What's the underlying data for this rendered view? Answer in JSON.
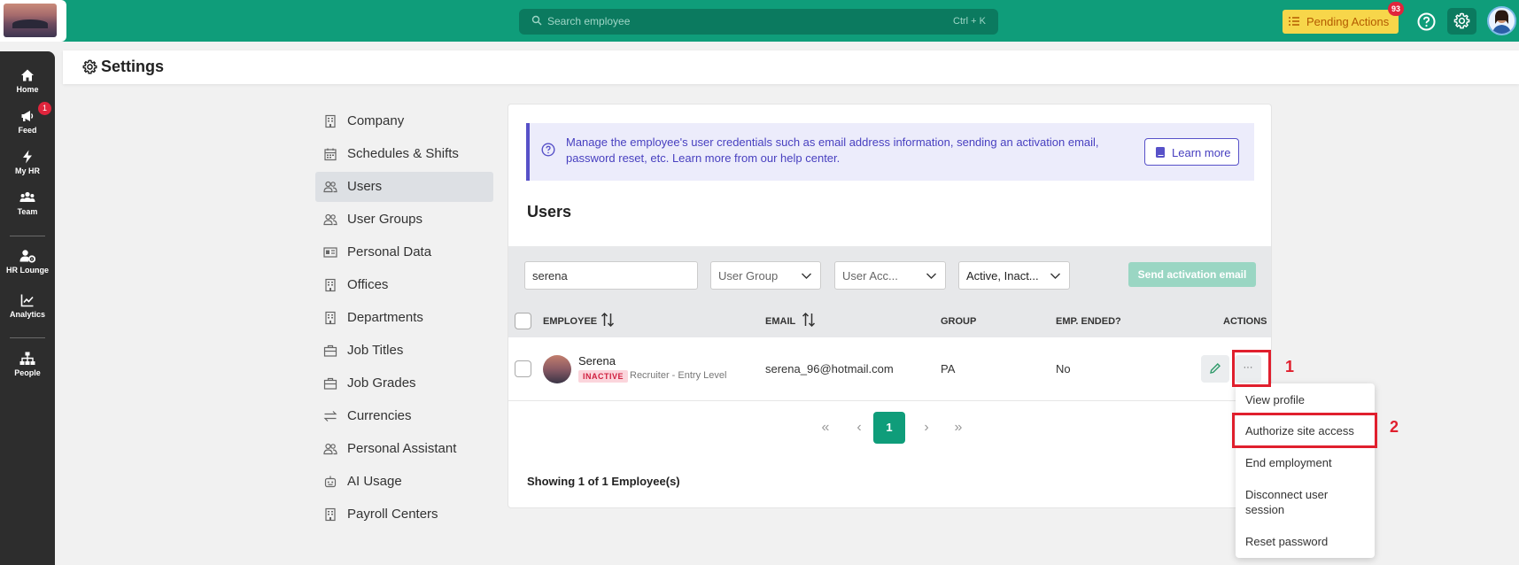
{
  "topbar": {
    "search_placeholder": "Search employee",
    "search_shortcut": "Ctrl + K",
    "pending_label": "Pending Actions",
    "pending_count": "93"
  },
  "sidebar": {
    "items": [
      {
        "label": "Home",
        "icon": "home-icon"
      },
      {
        "label": "Feed",
        "icon": "megaphone-icon",
        "badge": "1"
      },
      {
        "label": "My HR",
        "icon": "bolt-icon"
      },
      {
        "label": "Team",
        "icon": "team-icon"
      },
      {
        "label": "HR Lounge",
        "icon": "user-gear-icon"
      },
      {
        "label": "Analytics",
        "icon": "chart-icon"
      },
      {
        "label": "People",
        "icon": "org-chart-icon"
      }
    ]
  },
  "header": {
    "title": "Settings"
  },
  "menu": {
    "items": [
      {
        "label": "Company",
        "icon": "building-icon"
      },
      {
        "label": "Schedules & Shifts",
        "icon": "calendar-icon"
      },
      {
        "label": "Users",
        "icon": "users-icon",
        "active": true
      },
      {
        "label": "User Groups",
        "icon": "users-icon"
      },
      {
        "label": "Personal Data",
        "icon": "id-card-icon"
      },
      {
        "label": "Offices",
        "icon": "building-icon"
      },
      {
        "label": "Departments",
        "icon": "building-icon"
      },
      {
        "label": "Job Titles",
        "icon": "briefcase-icon"
      },
      {
        "label": "Job Grades",
        "icon": "briefcase-icon"
      },
      {
        "label": "Currencies",
        "icon": "exchange-icon"
      },
      {
        "label": "Personal Assistant",
        "icon": "users-icon"
      },
      {
        "label": "AI Usage",
        "icon": "robot-icon"
      },
      {
        "label": "Payroll Centers",
        "icon": "building-icon"
      }
    ]
  },
  "info": {
    "text": "Manage the employee's user credentials such as email address information, sending an activation email, password reset, etc. Learn more from our help center.",
    "learn_more": "Learn more"
  },
  "users": {
    "title": "Users",
    "filters": {
      "search_value": "serena",
      "user_group": "User Group",
      "user_access": "User Acc...",
      "status": "Active, Inact..."
    },
    "send_activation": "Send activation email",
    "columns": {
      "employee": "EMPLOYEE",
      "email": "EMAIL",
      "group": "GROUP",
      "emp_ended": "EMP. ENDED?",
      "actions": "ACTIONS"
    },
    "rows": [
      {
        "name": "Serena",
        "status": "INACTIVE",
        "job": "Recruiter - Entry Level",
        "email": "serena_96@hotmail.com",
        "group": "PA",
        "emp_ended": "No"
      }
    ],
    "pagination": {
      "current": "1",
      "first": "«",
      "prev": "‹",
      "next": "›",
      "last": "»"
    },
    "showing": "Showing 1 of 1 Employee(s)"
  },
  "actions_menu": {
    "items": [
      "View profile",
      "Authorize site access",
      "End employment",
      "Disconnect user session",
      "Reset password"
    ]
  },
  "annotations": {
    "step1": "1",
    "step2": "2"
  },
  "colors": {
    "brand": "#0f9d7a",
    "accent": "#5751c8",
    "highlight": "#e01f2d",
    "pending": "#f7d64a"
  }
}
